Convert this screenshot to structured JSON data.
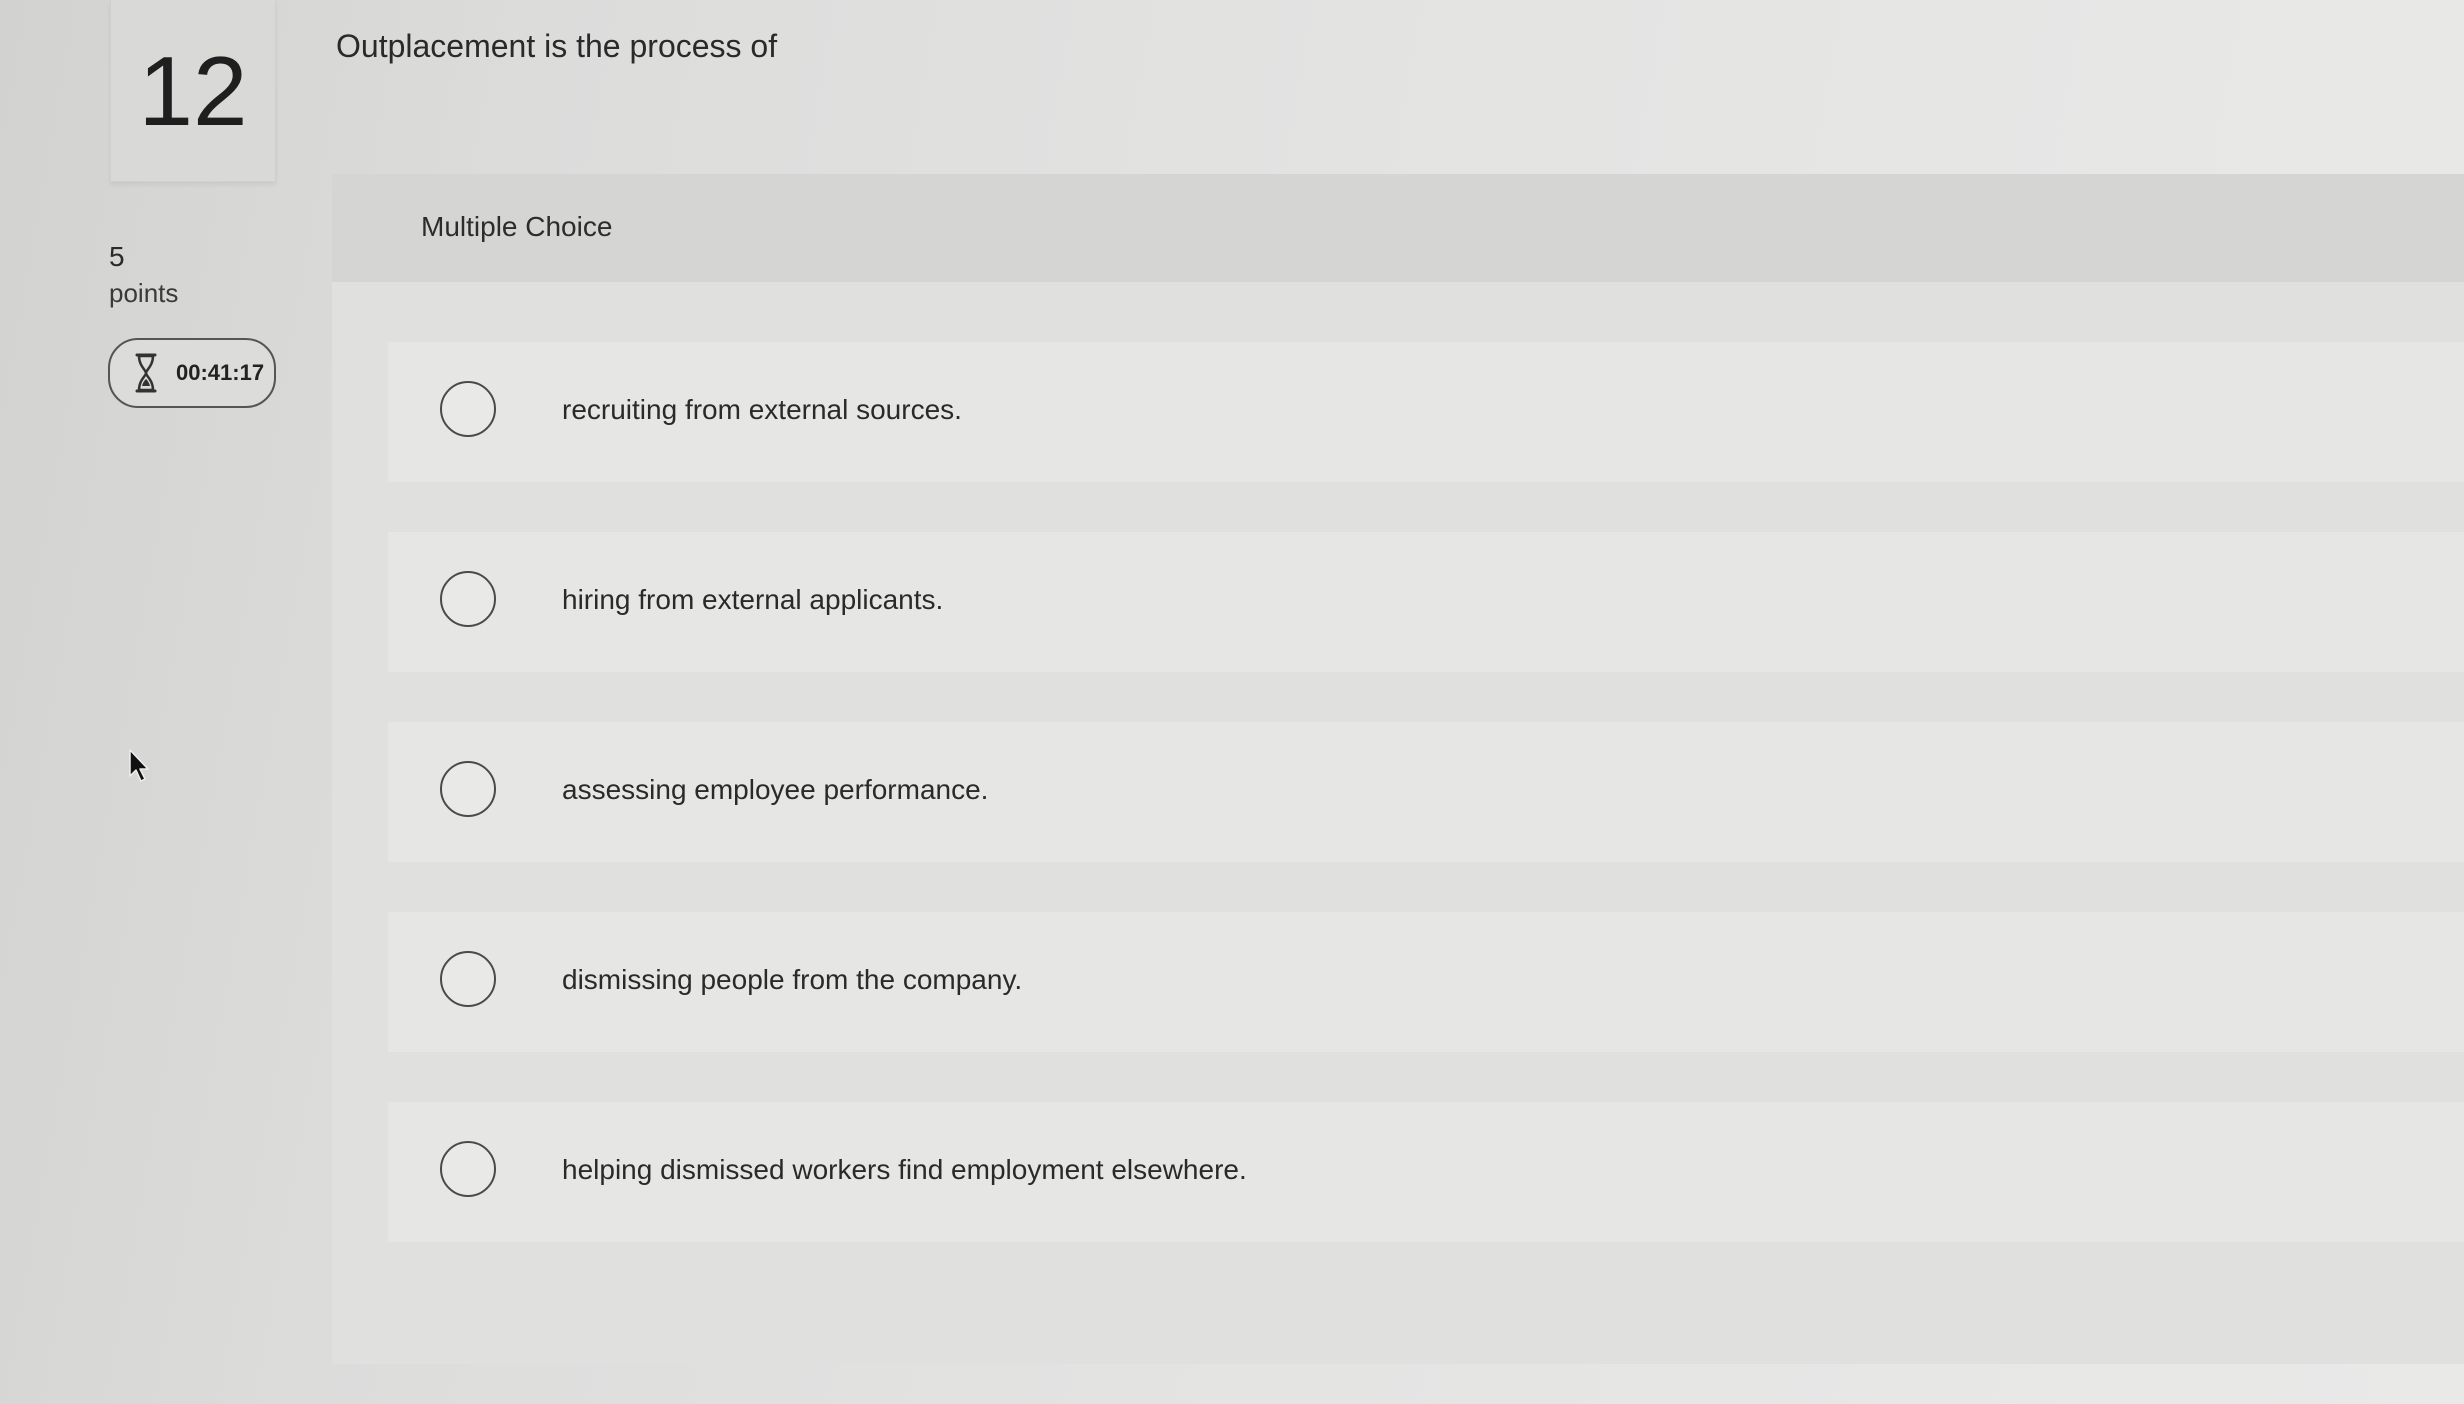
{
  "question": {
    "number": "12",
    "text": "Outplacement is the process of",
    "points_value": "5",
    "points_label": "points",
    "type": "Multiple Choice"
  },
  "timer": {
    "text": "00:41:17",
    "icon": "hourglass-icon"
  },
  "choices": [
    {
      "label": "recruiting from external sources.",
      "selected": false
    },
    {
      "label": "hiring from external applicants.",
      "selected": false
    },
    {
      "label": "assessing employee performance.",
      "selected": false
    },
    {
      "label": "dismissing people from the company.",
      "selected": false
    },
    {
      "label": "helping dismissed workers find employment elsewhere.",
      "selected": false
    }
  ]
}
